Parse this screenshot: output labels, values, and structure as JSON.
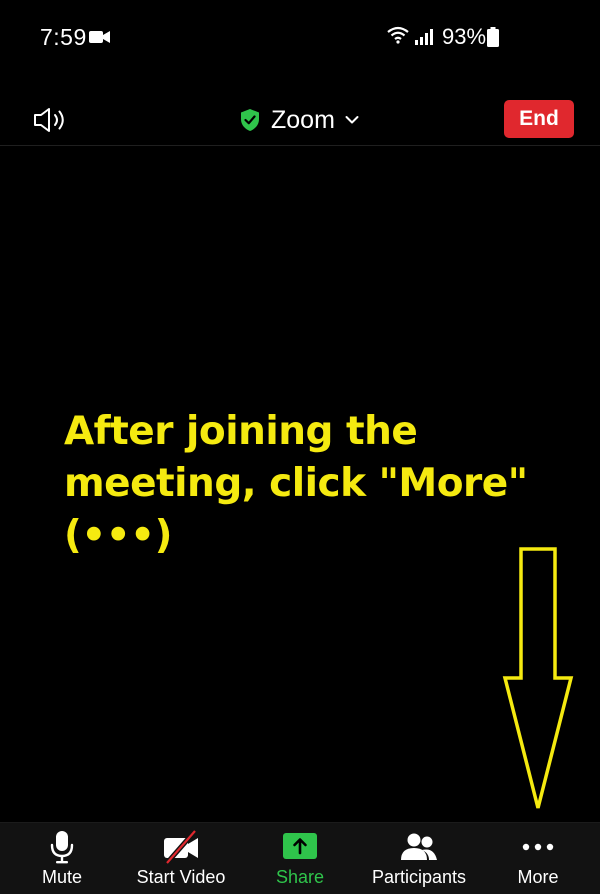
{
  "status_bar": {
    "time": "7:59",
    "battery": "93%",
    "icons": [
      "video-camera-icon",
      "wifi-icon",
      "signal-icon",
      "battery-icon"
    ]
  },
  "header": {
    "title": "Zoom",
    "end_label": "End",
    "icons": [
      "speaker-icon",
      "shield-check-icon",
      "chevron-down-icon"
    ],
    "colors": {
      "end": "#e0282e",
      "shield": "#2fc44b"
    }
  },
  "annotation": {
    "text": "After joining the\nmeeting, click \"More\"\n(•••)",
    "color": "#f5ea10"
  },
  "toolbar": {
    "mute_label": "Mute",
    "video_label": "Start Video",
    "share_label": "Share",
    "participants_label": "Participants",
    "more_label": "More",
    "icons": [
      "microphone-icon",
      "video-off-icon",
      "share-arrow-icon",
      "participants-icon",
      "more-dots-icon"
    ],
    "colors": {
      "share": "#2fc44b"
    }
  }
}
